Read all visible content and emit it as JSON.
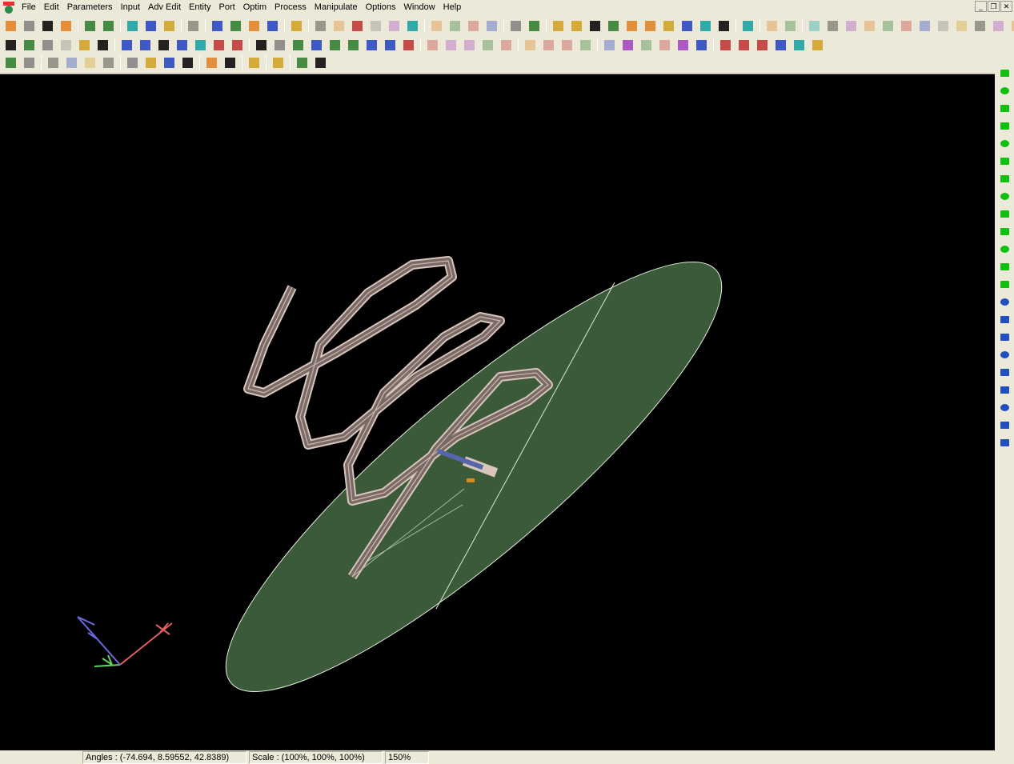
{
  "menu": [
    "File",
    "Edit",
    "Parameters",
    "Input",
    "Adv Edit",
    "Entity",
    "Port",
    "Optim",
    "Process",
    "Manipulate",
    "Options",
    "Window",
    "Help"
  ],
  "toolbar1": [
    "new-file",
    "open-folder",
    "save",
    "print",
    "|",
    "help",
    "context-help",
    "|",
    "layers",
    "layer-stack",
    "opt",
    "|",
    "esc",
    "|",
    "pencil",
    "select-arrow",
    "select-box",
    "select-box-2",
    "|",
    "eye",
    "|",
    "cut",
    "copy",
    "paste",
    "delete",
    "duplicate",
    "camera",
    "|",
    "group-1",
    "group-2",
    "group-3",
    "group-4",
    "|",
    "cursor",
    "node-select",
    "|",
    "line",
    "arc",
    "rect",
    "circle",
    "text",
    "via",
    "polygon",
    "port",
    "port-2",
    "port-3",
    "|",
    "gap",
    "|",
    "undo",
    "redo",
    "|",
    "shape-1",
    "shape-2",
    "shape-3",
    "shape-4",
    "shape-5",
    "shape-6",
    "shape-7",
    "shape-8",
    "shape-9",
    "shape-10",
    "shape-11",
    "shape-12"
  ],
  "toolbar2": [
    "port-1",
    "port-box",
    "port-plain",
    "port-gray",
    "port-pair",
    "port-multi",
    "|",
    "mesh",
    "run",
    "sphere",
    "run-fields",
    "run-fields-2",
    "current",
    "report",
    "|",
    "radiation",
    "chart",
    "field-pipe",
    "temperature",
    "spectrum",
    "pattern",
    "gradient",
    "heatmap",
    "graph",
    "|",
    "all",
    "zoom-box",
    "zoom-in",
    "zoom-out",
    "zoom-fit",
    "|",
    "left",
    "right",
    "down",
    "up",
    "|",
    "vs",
    "plus-v",
    "align-v",
    "align-h",
    "box",
    "corner",
    "|",
    "yellow-block",
    "blue-sphere",
    "color-grid",
    "color-cube",
    "bar",
    "check-grid"
  ],
  "toolbar3": [
    "save-view",
    "grid-points",
    "|",
    "all",
    "zoom-in",
    "zoom-out",
    "zoom-page",
    "|",
    "axes",
    "list",
    "port-table",
    "triangle-port",
    "|",
    "wave",
    "wave-arrow",
    "|",
    "puzzle",
    "|",
    "bulb",
    "|",
    "monitor",
    "paint-bucket"
  ],
  "rightbar": [
    "wire",
    "t-junction",
    "y-junction",
    "stub",
    "bend",
    "ellipse",
    "slot",
    "arch",
    "cylinder",
    "tube",
    "disc",
    "coil",
    "spiral",
    "square-port",
    "circle-port",
    "patch",
    "ring",
    "ring-2",
    "capacitor",
    "bridge",
    "ramp",
    "block"
  ],
  "status": {
    "angles": "Angles : (-74.694, 8.59552, 42.8389)",
    "scale": "Scale : (100%, 100%, 100%)",
    "zoom": "150%"
  },
  "window_buttons": [
    "_",
    "❐",
    "✕"
  ],
  "colors": {
    "viewport": "#000000",
    "plane": "#3a5a3a",
    "coil": "#d9c8c0",
    "axis_x": "#e06060",
    "axis_y": "#60d060",
    "axis_z": "#6a6ae0"
  }
}
